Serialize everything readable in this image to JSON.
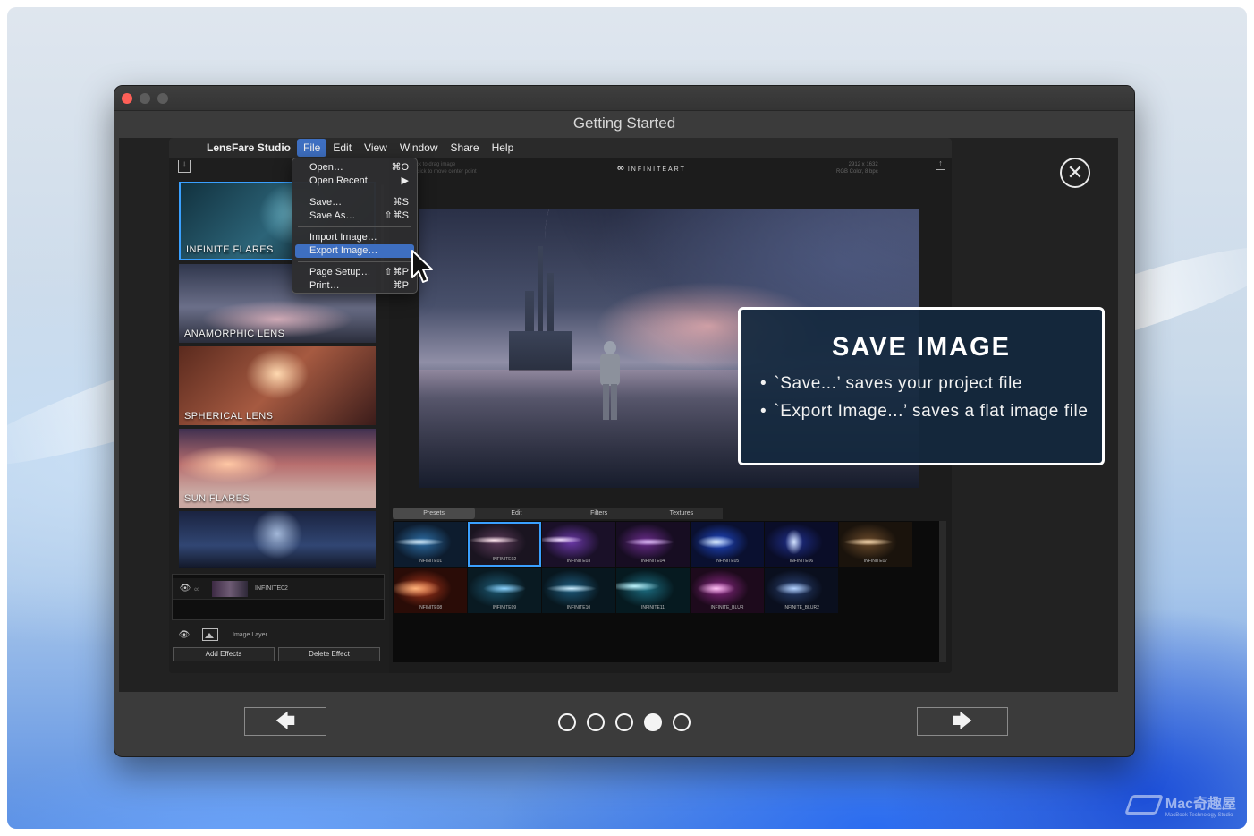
{
  "window": {
    "title": "Getting Started",
    "close_glyph": "✕"
  },
  "app": {
    "apple_glyph": "",
    "menu": [
      "LensFare Studio",
      "File",
      "Edit",
      "View",
      "Window",
      "Share",
      "Help"
    ],
    "file_menu": {
      "open": {
        "label": "Open…",
        "shortcut": "⌘O"
      },
      "open_recent": {
        "label": "Open Recent",
        "shortcut": "▶"
      },
      "save": {
        "label": "Save…",
        "shortcut": "⌘S"
      },
      "save_as": {
        "label": "Save As…",
        "shortcut": "⇧⌘S"
      },
      "import_image": {
        "label": "Import Image…"
      },
      "export_image": {
        "label": "Export Image…"
      },
      "page_setup": {
        "label": "Page Setup…",
        "shortcut": "⇧⌘P"
      },
      "print": {
        "label": "Print…",
        "shortcut": "⌘P"
      }
    },
    "sidebar": {
      "thumbnails": [
        "INFINITE FLARES",
        "ANAMORPHIC LENS",
        "SPHERICAL LENS",
        "SUN FLARES",
        ""
      ],
      "layer_name": "INFINITE02",
      "image_layer_label": "Image Layer",
      "add_effects": "Add Effects",
      "delete_effect": "Delete Effect"
    },
    "canvas": {
      "hint_line1": "ck to drag image",
      "hint_line2": "click to move center point",
      "brand": "INFINITEART",
      "brand_glyph": "∞",
      "dims_line1": "2912 x 1632",
      "dims_line2": "RGB Color, 8 bpc"
    },
    "tabs": [
      "Presets",
      "Edit",
      "Filters",
      "Textures"
    ],
    "presets": [
      "INFINITE01",
      "INFINITE02",
      "INFINITE03",
      "INFINITE04",
      "INFINITE05",
      "INFINITE06",
      "INFINITE07",
      "INFINITE08",
      "INFINITE09",
      "INFINITE10",
      "INFINITE11",
      "INFINITE_BLUR",
      "INFINITE_BLUR2"
    ]
  },
  "callout": {
    "title": "SAVE IMAGE",
    "bullets": [
      "`Save...’ saves your project file",
      "`Export Image...’ saves a flat image file"
    ]
  },
  "navigation": {
    "prev_glyph": "🡄",
    "next_glyph": "🡆",
    "page_count": 5,
    "current_page": 4
  },
  "watermark": {
    "text": "Mac奇趣屋",
    "sub": "MacBook Technology Studio"
  },
  "colors": {
    "accent_blue": "#3e6fc1",
    "selection_blue": "#3aa0ff",
    "callout_bg": "#14283e"
  }
}
